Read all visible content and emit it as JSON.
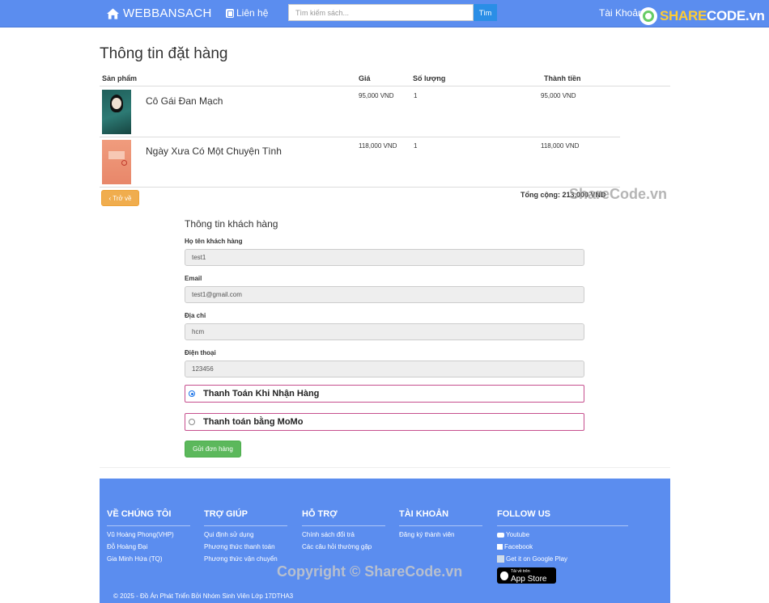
{
  "nav": {
    "brand": "WEBBANSACH",
    "contact": "Liên hệ",
    "search_placeholder": "Tìm kiếm sách...",
    "search_button": "Tìm",
    "account": "Tài Khoản",
    "watermark_logo_a": "SHARE",
    "watermark_logo_b": "CODE.vn"
  },
  "page_title": "Thông tin đặt hàng",
  "cart": {
    "headers": {
      "product": "Sản phẩm",
      "price": "Giá",
      "qty": "Số lượng",
      "subtotal": "Thành tiền"
    },
    "items": [
      {
        "name": "Cô Gái Đan Mạch",
        "price": "95,000 VND",
        "qty": "1",
        "subtotal": "95,000 VND",
        "cover_color": "#2d7a74"
      },
      {
        "name": "Ngày Xưa Có Một Chuyện Tình",
        "price": "118,000 VND",
        "qty": "1",
        "subtotal": "118,000 VND",
        "cover_color": "#e8876a"
      }
    ],
    "back_button": "‹ Trở về",
    "total": "Tổng cộng: 213,000 VND",
    "watermark": "ShareCode.vn"
  },
  "customer": {
    "title": "Thông tin khách hàng",
    "name_label": "Họ tên khách hàng",
    "name_value": "test1",
    "email_label": "Email",
    "email_value": "test1@gmail.com",
    "address_label": "Địa chỉ",
    "address_value": "hcm",
    "phone_label": "Điện thoại",
    "phone_value": "123456",
    "pay_cod": "Thanh Toán Khi Nhận Hàng",
    "pay_momo": "Thanh toán bằng MoMo",
    "submit": "Gửi đơn hàng"
  },
  "footer": {
    "about_title": "VỀ CHÚNG TÔI",
    "about": [
      "Vũ Hoàng Phong(VHP)",
      "Đỗ Hoàng Đại",
      "Gia Minh Hứa (TQ)"
    ],
    "help_title": "TRỢ GIÚP",
    "help": [
      "Qui định sử dụng",
      "Phương thức thanh toán",
      "Phương thức vận chuyển"
    ],
    "support_title": "HỖ TRỢ",
    "support": [
      "Chính sách đổi trả",
      "Các câu hỏi thường gặp"
    ],
    "account_title": "TÀI KHOẢN",
    "account": [
      "Đăng ký thành viên"
    ],
    "follow_title": "FOLLOW US",
    "youtube": "Youtube",
    "facebook": "Facebook",
    "google_play": "Get it on Google Play",
    "app_store_small": "Tải về trên",
    "app_store": "App Store",
    "copyright": "© 2025 - Đồ Án Phát Triển Bởi Nhóm Sinh Viên Lớp 17DTHA3",
    "watermark": "Copyright © ShareCode.vn"
  }
}
